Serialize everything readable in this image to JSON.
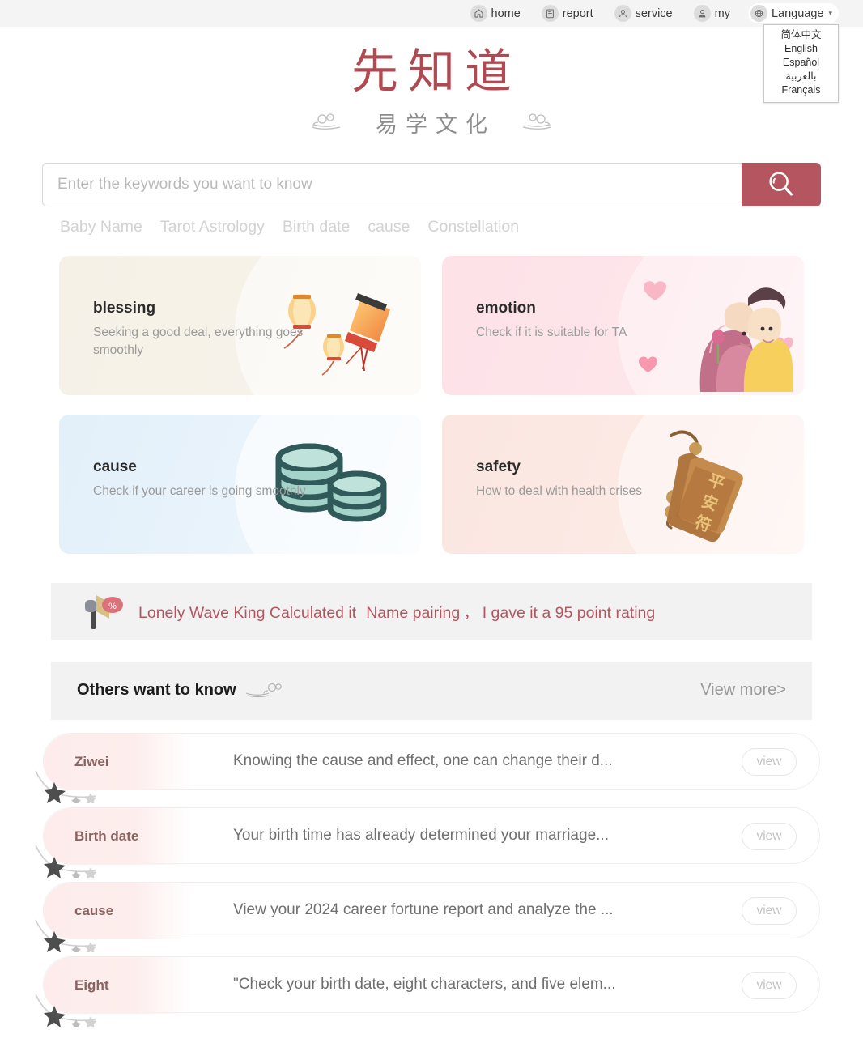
{
  "topnav": {
    "items": [
      {
        "label": "home",
        "icon": "home-icon"
      },
      {
        "label": "report",
        "icon": "report-icon"
      },
      {
        "label": "service",
        "icon": "service-icon"
      },
      {
        "label": "my",
        "icon": "user-icon"
      }
    ],
    "language": {
      "label": "Language",
      "icon": "globe-icon",
      "caret": "▾",
      "options": [
        "简体中文",
        "English",
        "Español",
        "بالعربية",
        "Français"
      ]
    }
  },
  "logo": {
    "main": "先知道",
    "sub": "易学文化",
    "main_color": "#b04a52",
    "sub_color": "#8d8d8d"
  },
  "search": {
    "placeholder": "Enter the keywords you want to know",
    "value": "",
    "button_icon": "search-icon",
    "button_color": "#b5555f"
  },
  "tags": [
    "Baby Name",
    "Tarot Astrology",
    "Birth date",
    "cause",
    "Constellation"
  ],
  "cards": [
    {
      "title": "blessing",
      "desc": "Seeking a good deal, everything goes smoothly",
      "art": "lanterns-illustration",
      "bg": "#f6f1e7"
    },
    {
      "title": "emotion",
      "desc": "Check if it is suitable for TA",
      "art": "couple-illustration",
      "bg": "#fde2e8"
    },
    {
      "title": "cause",
      "desc": "Check if your career is going smoothly",
      "art": "coins-illustration",
      "bg": "#e2f0fa"
    },
    {
      "title": "safety",
      "desc": "How to deal with health crises",
      "art": "amulet-illustration",
      "bg": "#fbe6e1"
    }
  ],
  "announcement": {
    "icon": "megaphone-icon",
    "seg1": "Lonely Wave King Calculated it",
    "seg2": "Name pairing",
    "comma": "，",
    "seg3": "I gave it a 95 point rating",
    "color": "#b4555e"
  },
  "others": {
    "title": "Others want to know",
    "ornament": "cloud-icon",
    "view_more": "View more",
    "chevron": ">"
  },
  "list": {
    "button_label": "view",
    "rows": [
      {
        "tag": "Ziwei",
        "text": "Knowing the cause and effect, one can change their d..."
      },
      {
        "tag": "Birth date",
        "text": "Your birth time has already determined your marriage..."
      },
      {
        "tag": "cause",
        "text": "View your 2024 career fortune report and analyze the ..."
      },
      {
        "tag": "Eight",
        "text": "\"Check your birth date, eight characters, and five elem..."
      }
    ]
  }
}
